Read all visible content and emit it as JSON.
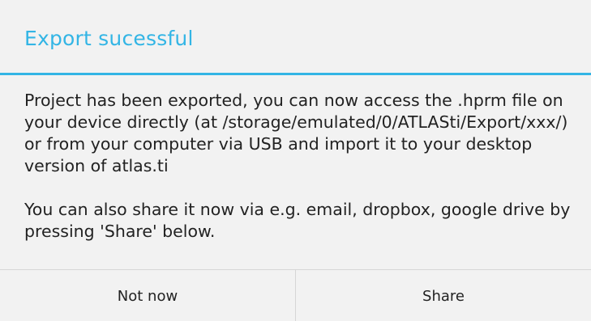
{
  "dialog": {
    "title": "Export sucessful",
    "message_paragraph_1": "Project has been exported, you can now access the .hprm file on your device directly (at /storage/emulated/0/ATLASti/Export/xxx/) or from your computer via USB and import it to your desktop version of atlas.ti",
    "message_paragraph_2": "You can also share it now via e.g. email, dropbox, google drive by pressing 'Share' below.",
    "buttons": {
      "negative_label": "Not now",
      "positive_label": "Share"
    },
    "accent_color": "#33b5e5"
  }
}
